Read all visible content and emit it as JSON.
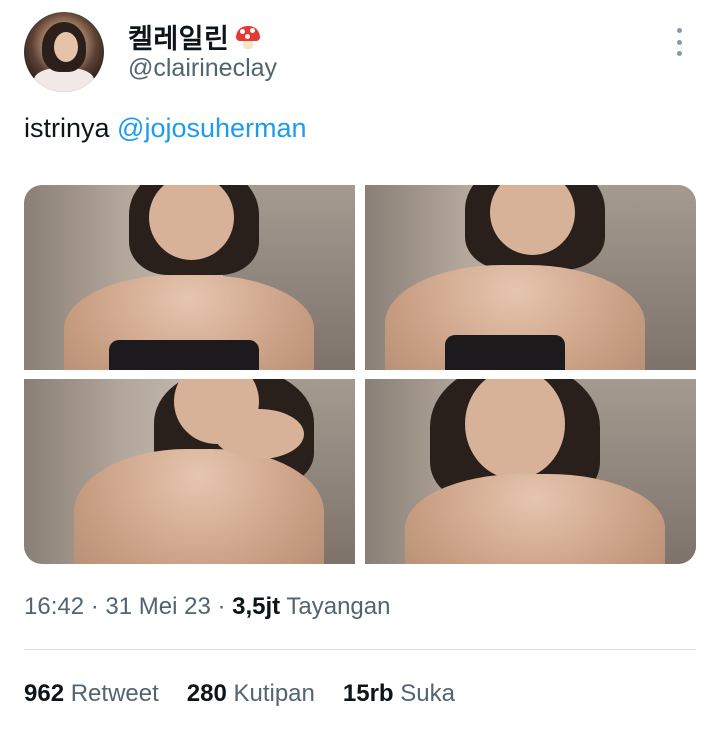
{
  "author": {
    "display_name": "켈레일린",
    "emoji": "mushroom-icon",
    "handle": "@clairineclay"
  },
  "tweet": {
    "text": "istrinya ",
    "mention": "@jojosuherman",
    "media_count": 4
  },
  "meta": {
    "time": "16:42",
    "sep1": " · ",
    "date": "31 Mei 23",
    "sep2": " · ",
    "views_count": "3,5jt",
    "views_label": " Tayangan"
  },
  "stats": {
    "retweets_count": "962",
    "retweets_label": " Retweet",
    "quotes_count": "280",
    "quotes_label": " Kutipan",
    "likes_count": "15rb",
    "likes_label": " Suka"
  },
  "colors": {
    "link": "#1d9bf0",
    "secondary_text": "#536471",
    "primary_text": "#0f1419"
  }
}
